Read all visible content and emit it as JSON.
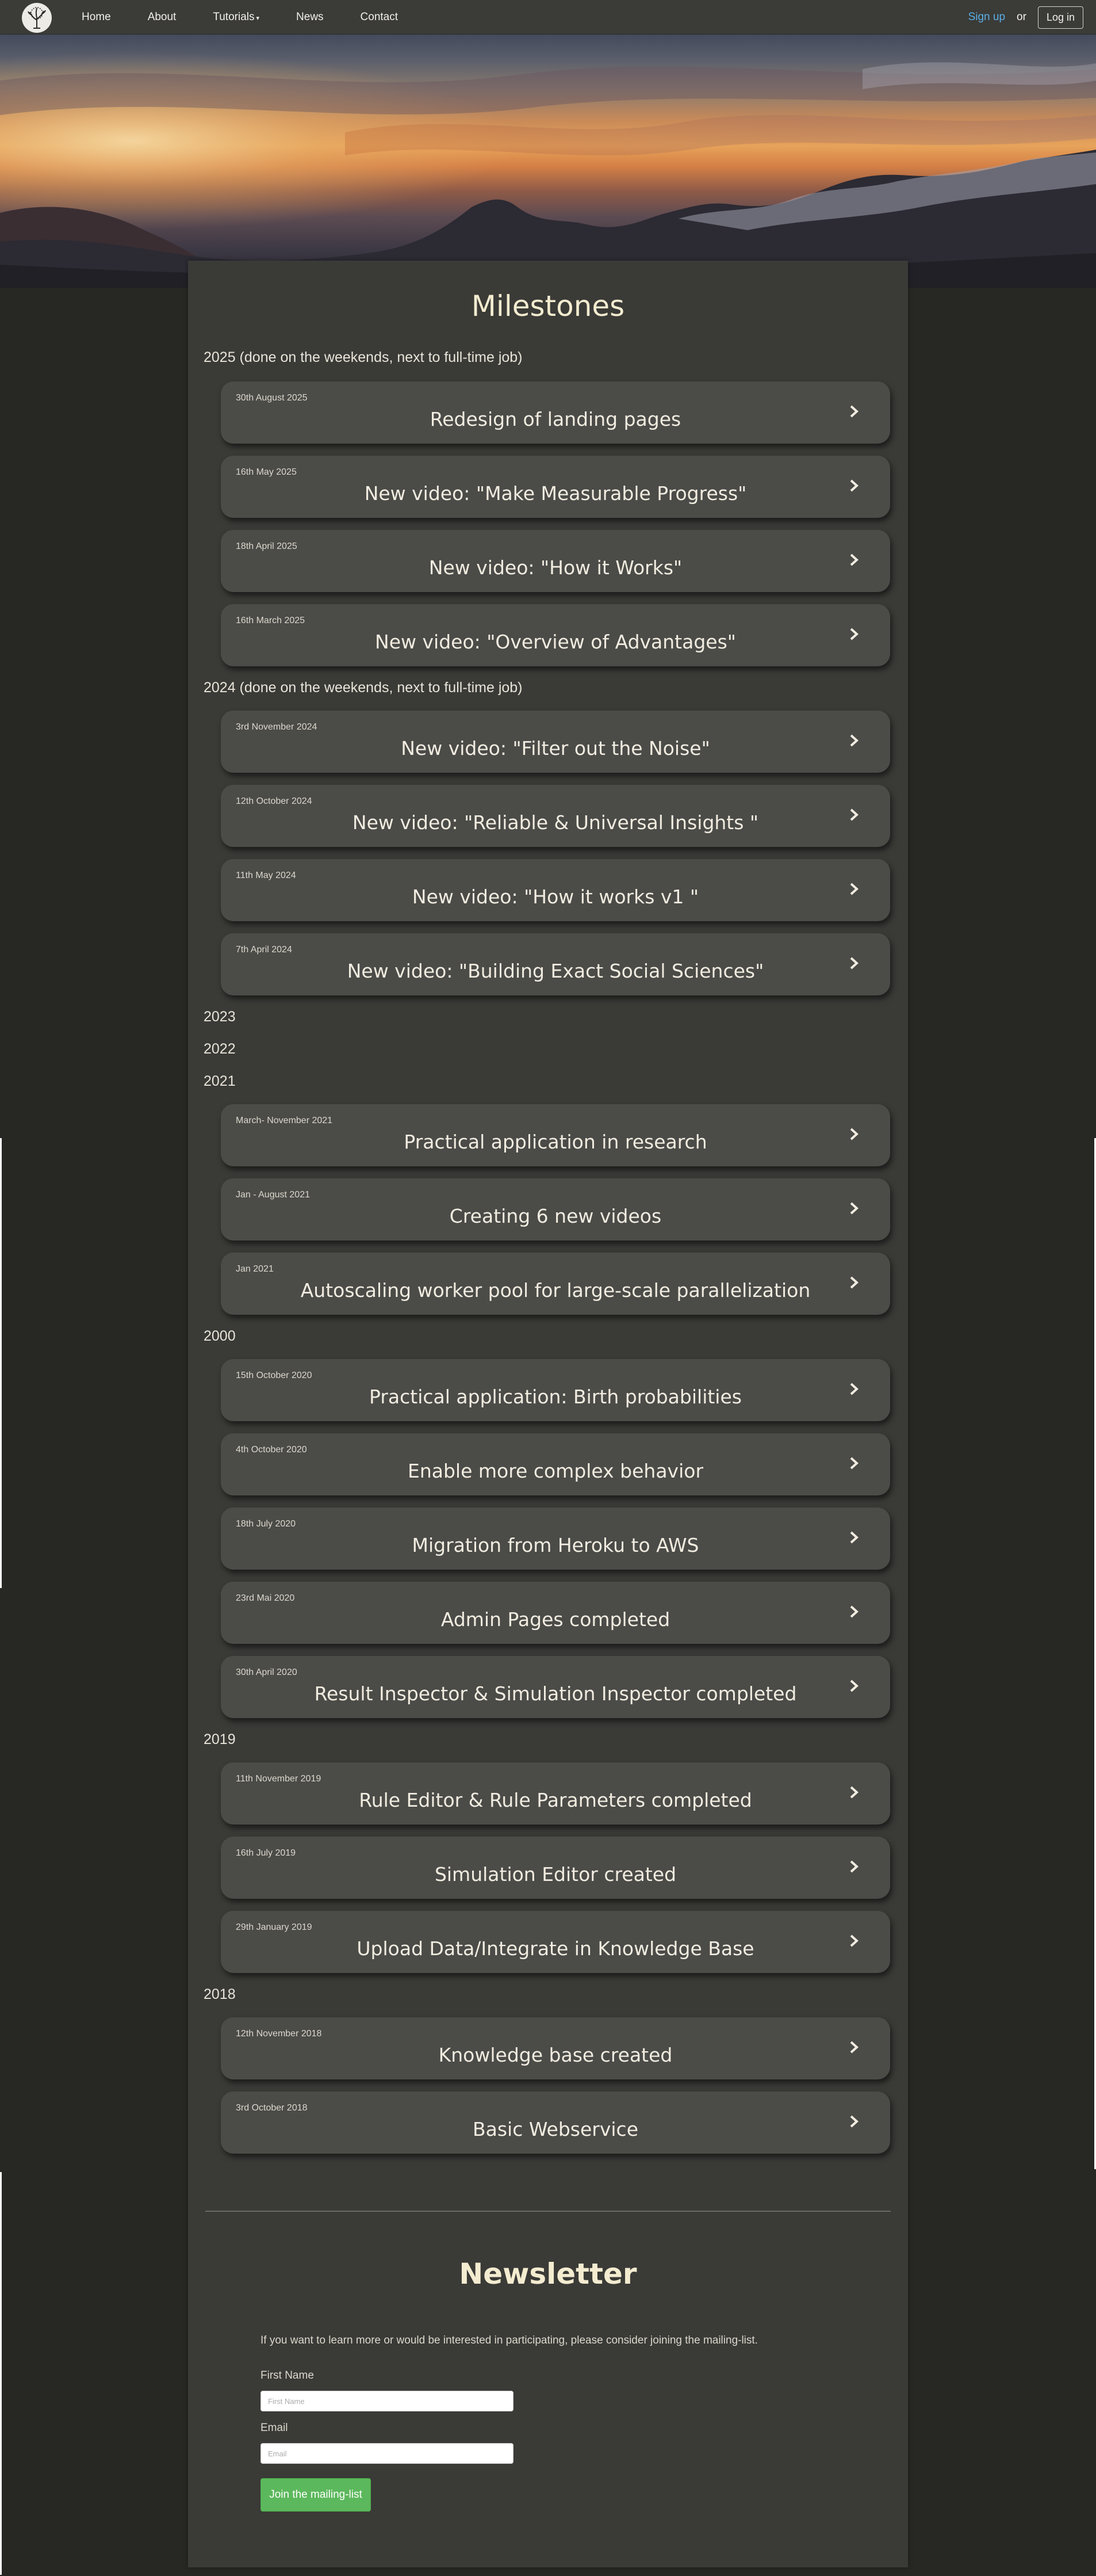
{
  "nav": {
    "links": [
      "Home",
      "About",
      "Tutorials",
      "News",
      "Contact"
    ],
    "signup": "Sign up",
    "or": "or",
    "login": "Log in"
  },
  "page_title": "Milestones",
  "years": [
    "2025 (done on the weekends, next to full-time job)",
    "2024 (done on the weekends, next to full-time job)",
    "2023",
    "2022",
    "2021",
    "2000",
    "2019",
    "2018"
  ],
  "milestones": [
    {
      "date": "30th August 2025",
      "title": "Redesign of landing pages"
    },
    {
      "date": "16th May 2025",
      "title": "New video: \"Make Measurable Progress\""
    },
    {
      "date": "18th April 2025",
      "title": "New video: \"How it Works\""
    },
    {
      "date": "16th March 2025",
      "title": "New video: \"Overview of Advantages\""
    },
    {
      "date": "3rd November 2024",
      "title": "New video: \"Filter out the Noise\""
    },
    {
      "date": "12th October 2024",
      "title": "New video: \"Reliable & Universal Insights \""
    },
    {
      "date": "11th May 2024",
      "title": "New video: \"How it works v1 \""
    },
    {
      "date": "7th April 2024",
      "title": "New video: \"Building Exact Social Sciences\""
    },
    {
      "date": "March- November 2021",
      "title": "Practical application in research"
    },
    {
      "date": "Jan - August 2021",
      "title": "Creating 6 new videos"
    },
    {
      "date": "Jan 2021",
      "title": "Autoscaling worker pool for large-scale parallelization"
    },
    {
      "date": "15th October 2020",
      "title": "Practical application: Birth probabilities"
    },
    {
      "date": "4th October 2020",
      "title": "Enable more complex behavior"
    },
    {
      "date": "18th July 2020",
      "title": "Migration from Heroku to AWS"
    },
    {
      "date": "23rd Mai 2020",
      "title": "Admin Pages completed"
    },
    {
      "date": "30th April 2020",
      "title": "Result Inspector & Simulation Inspector completed"
    },
    {
      "date": "11th November 2019",
      "title": "Rule Editor & Rule Parameters completed"
    },
    {
      "date": "16th July 2019",
      "title": "Simulation Editor created"
    },
    {
      "date": "29th January 2019",
      "title": "Upload Data/Integrate in Knowledge Base"
    },
    {
      "date": "12th November 2018",
      "title": "Knowledge base created"
    },
    {
      "date": "3rd October 2018",
      "title": "Basic Webservice"
    }
  ],
  "newsletter": {
    "title": "Newsletter",
    "text": "If you want to learn more or would be interested in participating, please consider joining the mailing-list.",
    "first_name_label": "First Name",
    "first_name_placeholder": "First Name",
    "email_label": "Email",
    "email_placeholder": "Email",
    "button": "Join the mailing-list"
  },
  "colors": {
    "page_bg": "#272723",
    "panel_bg": "#3a3a37",
    "card_bg": "#4b4b48",
    "accent_link": "#5aaee6",
    "button_green": "#5cb85c"
  }
}
